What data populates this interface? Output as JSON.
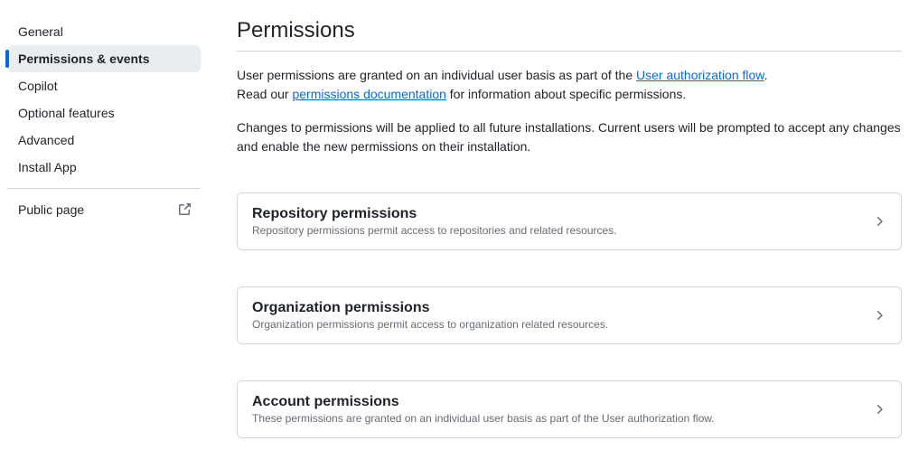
{
  "sidebar": {
    "items": [
      {
        "label": "General",
        "active": false
      },
      {
        "label": "Permissions & events",
        "active": true
      },
      {
        "label": "Copilot",
        "active": false
      },
      {
        "label": "Optional features",
        "active": false
      },
      {
        "label": "Advanced",
        "active": false
      },
      {
        "label": "Install App",
        "active": false
      }
    ],
    "secondary": [
      {
        "label": "Public page",
        "external": true
      }
    ]
  },
  "header": {
    "title": "Permissions"
  },
  "intro": {
    "line1_before": "User permissions are granted on an individual user basis as part of the ",
    "line1_link": "User authorization flow",
    "line1_after": ".",
    "line2_before": "Read our ",
    "line2_link": "permissions documentation",
    "line2_after": " for information about specific permissions.",
    "para2": "Changes to permissions will be applied to all future installations. Current users will be prompted to accept any changes and enable the new permissions on their installation."
  },
  "panels": [
    {
      "title": "Repository permissions",
      "desc": "Repository permissions permit access to repositories and related resources."
    },
    {
      "title": "Organization permissions",
      "desc": "Organization permissions permit access to organization related resources."
    },
    {
      "title": "Account permissions",
      "desc": "These permissions are granted on an individual user basis as part of the User authorization flow."
    }
  ]
}
